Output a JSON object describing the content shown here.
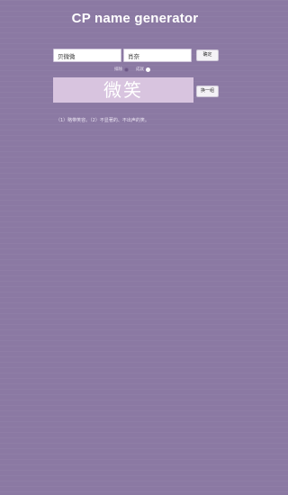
{
  "header": {
    "title": "CP name generator"
  },
  "form": {
    "name1": {
      "value": "贝微微",
      "placeholder": ""
    },
    "name2": {
      "value": "肖奈",
      "placeholder": ""
    },
    "confirm_label": "确定"
  },
  "mode_options": [
    {
      "label": "排除",
      "selected": false
    },
    {
      "label": "成就",
      "selected": true
    }
  ],
  "result": {
    "text": "微笑",
    "another_label": "换一组",
    "meaning": "（1）略带笑容。（2）不显著的、不出声的笑。"
  },
  "colors": {
    "background": "#8b79a3",
    "result_box": "#d8c4df",
    "radio_selected": "#ffffff",
    "radio_unselected": "#6a5584"
  }
}
